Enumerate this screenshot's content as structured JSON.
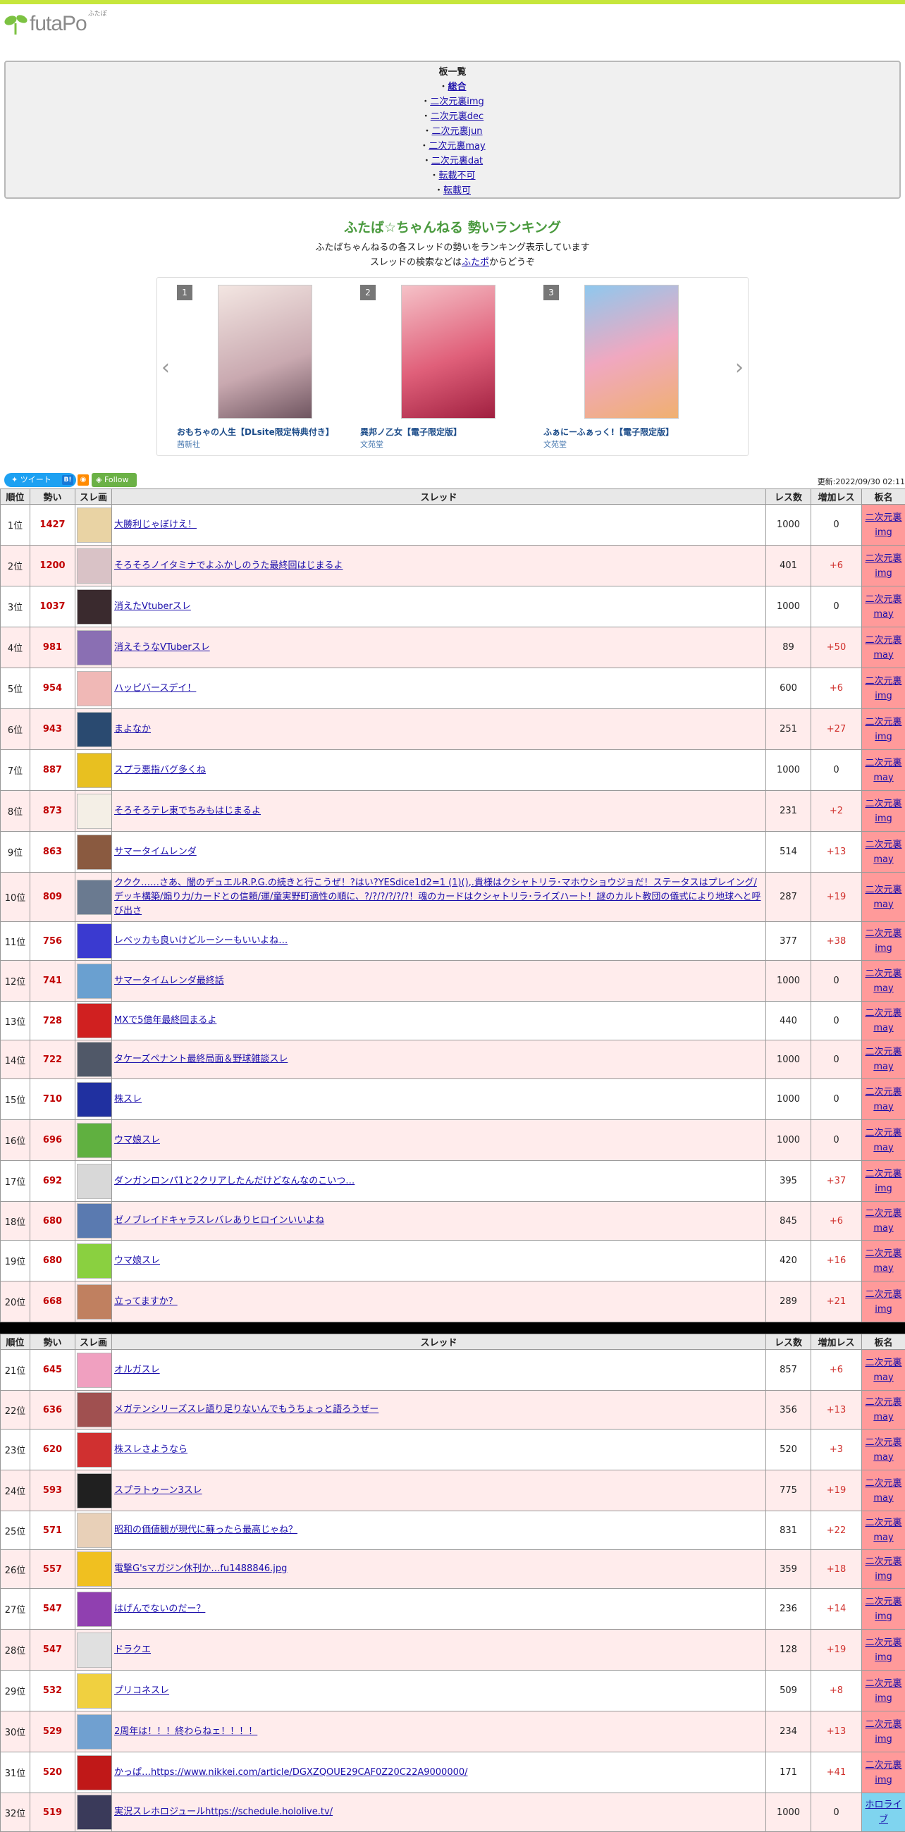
{
  "site": {
    "logo_text": "futaPo",
    "logo_kana": "ふたぽ"
  },
  "boards": {
    "title": "板一覧",
    "current": "総合",
    "items": [
      "二次元裏img",
      "二次元裏dec",
      "二次元裏jun",
      "二次元裏may",
      "二次元裏dat",
      "転載不可",
      "転載可"
    ]
  },
  "intro": {
    "title": "ふたば☆ちゃんねる 勢いランキング",
    "line1": "ふたばちゃんねるの各スレッドの勢いをランキング表示しています",
    "line2_pre": "スレッドの検索などは",
    "line2_link": "ふたポ",
    "line2_post": "からどうぞ"
  },
  "ads": [
    {
      "rank": "1",
      "title": "おもちゃの人生【DLsite限定特典付き】",
      "publisher": "茜新社"
    },
    {
      "rank": "2",
      "title": "異邦ノ乙女【電子限定版】",
      "publisher": "文苑堂"
    },
    {
      "rank": "3",
      "title": "ふぁにーふぁっく!【電子限定版】",
      "publisher": "文苑堂"
    }
  ],
  "social": {
    "tweet": "ツイート",
    "hatena": "B!",
    "follow": "Follow",
    "updated": "更新:2022/09/30 02:11"
  },
  "table_headers": {
    "rank": "順位",
    "score": "勢い",
    "thumb": "スレ画",
    "thread": "スレッド",
    "res": "レス数",
    "inc": "増加レス",
    "board": "板名"
  },
  "rows": [
    {
      "rank": "1位",
      "score": "1427",
      "title": "大勝利じゃぼけえ！",
      "res": "1000",
      "inc": "0",
      "board": [
        "二次元裏",
        "img"
      ],
      "thumb": "#e9d3a4",
      "h": 58
    },
    {
      "rank": "2位",
      "score": "1200",
      "title": "そろそろノイタミナでよふかしのうた最終回はじまるよ",
      "res": "401",
      "inc": "+6",
      "board": [
        "二次元裏",
        "img"
      ],
      "thumb": "#d9c2c6",
      "h": 58
    },
    {
      "rank": "3位",
      "score": "1037",
      "title": "消えたVtuberスレ",
      "res": "1000",
      "inc": "0",
      "board": [
        "二次元裏",
        "may"
      ],
      "thumb": "#3a2a2e",
      "h": 58
    },
    {
      "rank": "4位",
      "score": "981",
      "title": "消えそうなVTuberスレ",
      "res": "89",
      "inc": "+50",
      "board": [
        "二次元裏",
        "may"
      ],
      "thumb": "#8a6fb3",
      "h": 58
    },
    {
      "rank": "5位",
      "score": "954",
      "title": "ハッピバースデイ！",
      "res": "600",
      "inc": "+6",
      "board": [
        "二次元裏",
        "img"
      ],
      "thumb": "#f0b8b6",
      "h": 58
    },
    {
      "rank": "6位",
      "score": "943",
      "title": "まよなか",
      "res": "251",
      "inc": "+27",
      "board": [
        "二次元裏",
        "img"
      ],
      "thumb": "#2a4a70",
      "h": 58
    },
    {
      "rank": "7位",
      "score": "887",
      "title": "スプラ悪指バグ多くね",
      "res": "1000",
      "inc": "0",
      "board": [
        "二次元裏",
        "may"
      ],
      "thumb": "#e8c020",
      "h": 58
    },
    {
      "rank": "8位",
      "score": "873",
      "title": "そろそろテレ東でちみもはじまるよ",
      "res": "231",
      "inc": "+2",
      "board": [
        "二次元裏",
        "img"
      ],
      "thumb": "#f4efe6",
      "h": 58
    },
    {
      "rank": "9位",
      "score": "863",
      "title": "サマータイムレンダ",
      "res": "514",
      "inc": "+13",
      "board": [
        "二次元裏",
        "may"
      ],
      "thumb": "#8a5a40",
      "h": 58
    },
    {
      "rank": "10位",
      "score": "809",
      "title": "ククク……さあ、闇のデュエルR.P.G.の続きと行こうぜ！?はい?YESdice1d2=1 (1)(),.貴様はクシャトリラ･マホウショウジョだ！ステータスはプレイング/デッキ構築/煽り力/カードとの信頼/運/童実野町適性の順に、?/?/?/?/?/?！魂のカードはクシャトリラ･ライズハート！謎のカルト教団の儀式により地球へと呼び出さ",
      "res": "287",
      "inc": "+19",
      "board": [
        "二次元裏",
        "may"
      ],
      "thumb": "#6a7a90",
      "h": 70
    },
    {
      "rank": "11位",
      "score": "756",
      "title": "レベッカも良いけどルーシーもいいよね…",
      "res": "377",
      "inc": "+38",
      "board": [
        "二次元裏",
        "img"
      ],
      "thumb": "#3a3ad0",
      "h": 48
    },
    {
      "rank": "12位",
      "score": "741",
      "title": "サマータイムレンダ最終話",
      "res": "1000",
      "inc": "0",
      "board": [
        "二次元裏",
        "may"
      ],
      "thumb": "#6aa0d0",
      "h": 58
    },
    {
      "rank": "13位",
      "score": "728",
      "title": "MXで5億年最終回まるよ",
      "res": "440",
      "inc": "0",
      "board": [
        "二次元裏",
        "may"
      ],
      "thumb": "#d02020",
      "h": 46
    },
    {
      "rank": "14位",
      "score": "722",
      "title": "タケーズペナント最終局面＆野球雑談スレ",
      "res": "1000",
      "inc": "0",
      "board": [
        "二次元裏",
        "may"
      ],
      "thumb": "#505868",
      "h": 46
    },
    {
      "rank": "15位",
      "score": "710",
      "title": "株スレ",
      "res": "1000",
      "inc": "0",
      "board": [
        "二次元裏",
        "may"
      ],
      "thumb": "#2030a0",
      "h": 58
    },
    {
      "rank": "16位",
      "score": "696",
      "title": "ウマ娘スレ",
      "res": "1000",
      "inc": "0",
      "board": [
        "二次元裏",
        "may"
      ],
      "thumb": "#60b040",
      "h": 58
    },
    {
      "rank": "17位",
      "score": "692",
      "title": "ダンガンロンパ1と2クリアしたんだけどなんなのこいつ…",
      "res": "395",
      "inc": "+37",
      "board": [
        "二次元裏",
        "img"
      ],
      "thumb": "#d8d8d8",
      "h": 58
    },
    {
      "rank": "18位",
      "score": "680",
      "title": "ゼノブレイドキャラスレバレありヒロインいいよね",
      "res": "845",
      "inc": "+6",
      "board": [
        "二次元裏",
        "may"
      ],
      "thumb": "#5a7ab0",
      "h": 40
    },
    {
      "rank": "19位",
      "score": "680",
      "title": "ウマ娘スレ",
      "res": "420",
      "inc": "+16",
      "board": [
        "二次元裏",
        "may"
      ],
      "thumb": "#8ad040",
      "h": 58
    },
    {
      "rank": "20位",
      "score": "668",
      "title": "立ってますか？",
      "res": "289",
      "inc": "+21",
      "board": [
        "二次元裏",
        "img"
      ],
      "thumb": "#c08060",
      "h": 58
    }
  ],
  "rows2": [
    {
      "rank": "21位",
      "score": "645",
      "title": "オルガスレ",
      "res": "857",
      "inc": "+6",
      "board": [
        "二次元裏",
        "may"
      ],
      "thumb": "#f0a0c0",
      "h": 58
    },
    {
      "rank": "22位",
      "score": "636",
      "title": "メガテンシリーズスレ語り足りないんでもうちょっと語ろうぜー",
      "res": "356",
      "inc": "+13",
      "board": [
        "二次元裏",
        "may"
      ],
      "thumb": "#a05050",
      "h": 50
    },
    {
      "rank": "23位",
      "score": "620",
      "title": "株スレさようなら",
      "res": "520",
      "inc": "+3",
      "board": [
        "二次元裏",
        "may"
      ],
      "thumb": "#d03030",
      "h": 58
    },
    {
      "rank": "24位",
      "score": "593",
      "title": "スプラトゥーン3スレ",
      "res": "775",
      "inc": "+19",
      "board": [
        "二次元裏",
        "may"
      ],
      "thumb": "#202020",
      "h": 58
    },
    {
      "rank": "25位",
      "score": "571",
      "title": "昭和の価値観が現代に蘇ったら最高じゃね？",
      "res": "831",
      "inc": "+22",
      "board": [
        "二次元裏",
        "may"
      ],
      "thumb": "#e8d0b8",
      "h": 44
    },
    {
      "rank": "26位",
      "score": "557",
      "title": "電撃G'sマガジン休刊か…fu1488846.jpg",
      "res": "359",
      "inc": "+18",
      "board": [
        "二次元裏",
        "img"
      ],
      "thumb": "#f0c020",
      "h": 44
    },
    {
      "rank": "27位",
      "score": "547",
      "title": "はげんでないのだー？",
      "res": "236",
      "inc": "+14",
      "board": [
        "二次元裏",
        "img"
      ],
      "thumb": "#9040b0",
      "h": 58
    },
    {
      "rank": "28位",
      "score": "547",
      "title": "ドラクエ",
      "res": "128",
      "inc": "+19",
      "board": [
        "二次元裏",
        "img"
      ],
      "thumb": "#e0e0e0",
      "h": 58
    },
    {
      "rank": "29位",
      "score": "532",
      "title": "プリコネスレ",
      "res": "509",
      "inc": "+8",
      "board": [
        "二次元裏",
        "img"
      ],
      "thumb": "#f0d040",
      "h": 58
    },
    {
      "rank": "30位",
      "score": "529",
      "title": "2周年は！！！終わらねェ！！！！",
      "res": "234",
      "inc": "+13",
      "board": [
        "二次元裏",
        "img"
      ],
      "thumb": "#70a0d0",
      "h": 58
    },
    {
      "rank": "31位",
      "score": "520",
      "title": "かっぱ…https://www.nikkei.com/article/DGXZQOUE29CAF0Z20C22A9000000/",
      "res": "171",
      "inc": "+41",
      "board": [
        "二次元裏",
        "img"
      ],
      "thumb": "#c01818",
      "h": 58
    },
    {
      "rank": "32位",
      "score": "519",
      "title": "実況スレホロジュールhttps://schedule.hololive.tv/",
      "res": "1000",
      "inc": "0",
      "board": [
        "ホロライ",
        "ブ"
      ],
      "thumb": "#3a3a5a",
      "h": 48,
      "holo": true
    }
  ],
  "colors": {
    "accent_bar": "#c6e63c",
    "score": "#c00000",
    "board_bg": "#ff9a9a",
    "holo_bg": "#7fd4ef",
    "even_row": "#ffecec"
  }
}
